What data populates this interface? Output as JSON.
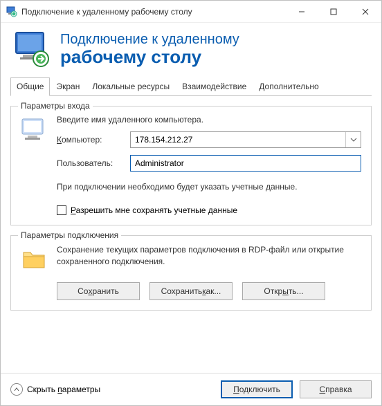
{
  "titlebar": {
    "title": "Подключение к удаленному рабочему столу"
  },
  "header": {
    "line1": "Подключение к удаленному",
    "line2": "рабочему столу"
  },
  "tabs": {
    "general": "Общие",
    "screen": "Экран",
    "local": "Локальные ресурсы",
    "experience": "Взаимодействие",
    "advanced": "Дополнительно"
  },
  "login": {
    "legend": "Параметры входа",
    "instruction": "Введите имя удаленного компьютера.",
    "computer_label": "Компьютер:",
    "computer_value": "178.154.212.27",
    "user_label": "Пользователь:",
    "user_value": "Administrator",
    "hint": "При подключении необходимо будет указать учетные данные.",
    "checkbox_label": "Разрешить мне сохранять учетные данные"
  },
  "connection": {
    "legend": "Параметры подключения",
    "text": "Сохранение текущих параметров подключения в RDP-файл или открытие сохраненного подключения.",
    "save": "Сохранить",
    "save_as": "Сохранить как...",
    "open": "Открыть..."
  },
  "footer": {
    "hide": "Скрыть параметры",
    "connect": "Подключить",
    "help": "Справка"
  }
}
